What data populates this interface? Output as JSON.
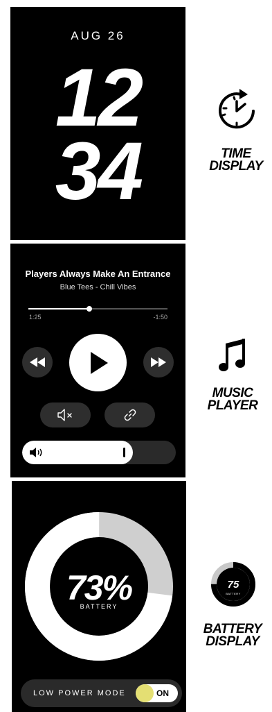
{
  "time_panel": {
    "date": "AUG 26",
    "hours": "12",
    "minutes": "34"
  },
  "music_panel": {
    "title": "Players Always Make An Entrance",
    "artist": "Blue Tees - Chill Vibes",
    "elapsed": "1:25",
    "remaining": "-1:50",
    "progress": 0.44,
    "volume": 0.72
  },
  "battery_panel": {
    "percent": "73%",
    "label": "BATTERY",
    "level": 0.73,
    "low_power_label": "LOW POWER MODE",
    "low_power_state": "ON",
    "ring_colors": {
      "filled": "#ffffff",
      "empty": "#cfcfcf"
    }
  },
  "features": {
    "time": {
      "line1": "TIME",
      "line2": "DISPLAY",
      "icon": "timer-icon"
    },
    "music": {
      "line1": "MUSIC",
      "line2": "PLAYER",
      "icon": "music-note-icon"
    },
    "battery": {
      "line1": "BATTERY",
      "line2": "DISPLAY",
      "icon": "battery-ring-icon",
      "icon_value": "75",
      "icon_label": "BATTERY",
      "icon_level": 0.75
    }
  },
  "colors": {
    "panel_bg": "#000000",
    "accent_toggle": "#e4df73"
  }
}
